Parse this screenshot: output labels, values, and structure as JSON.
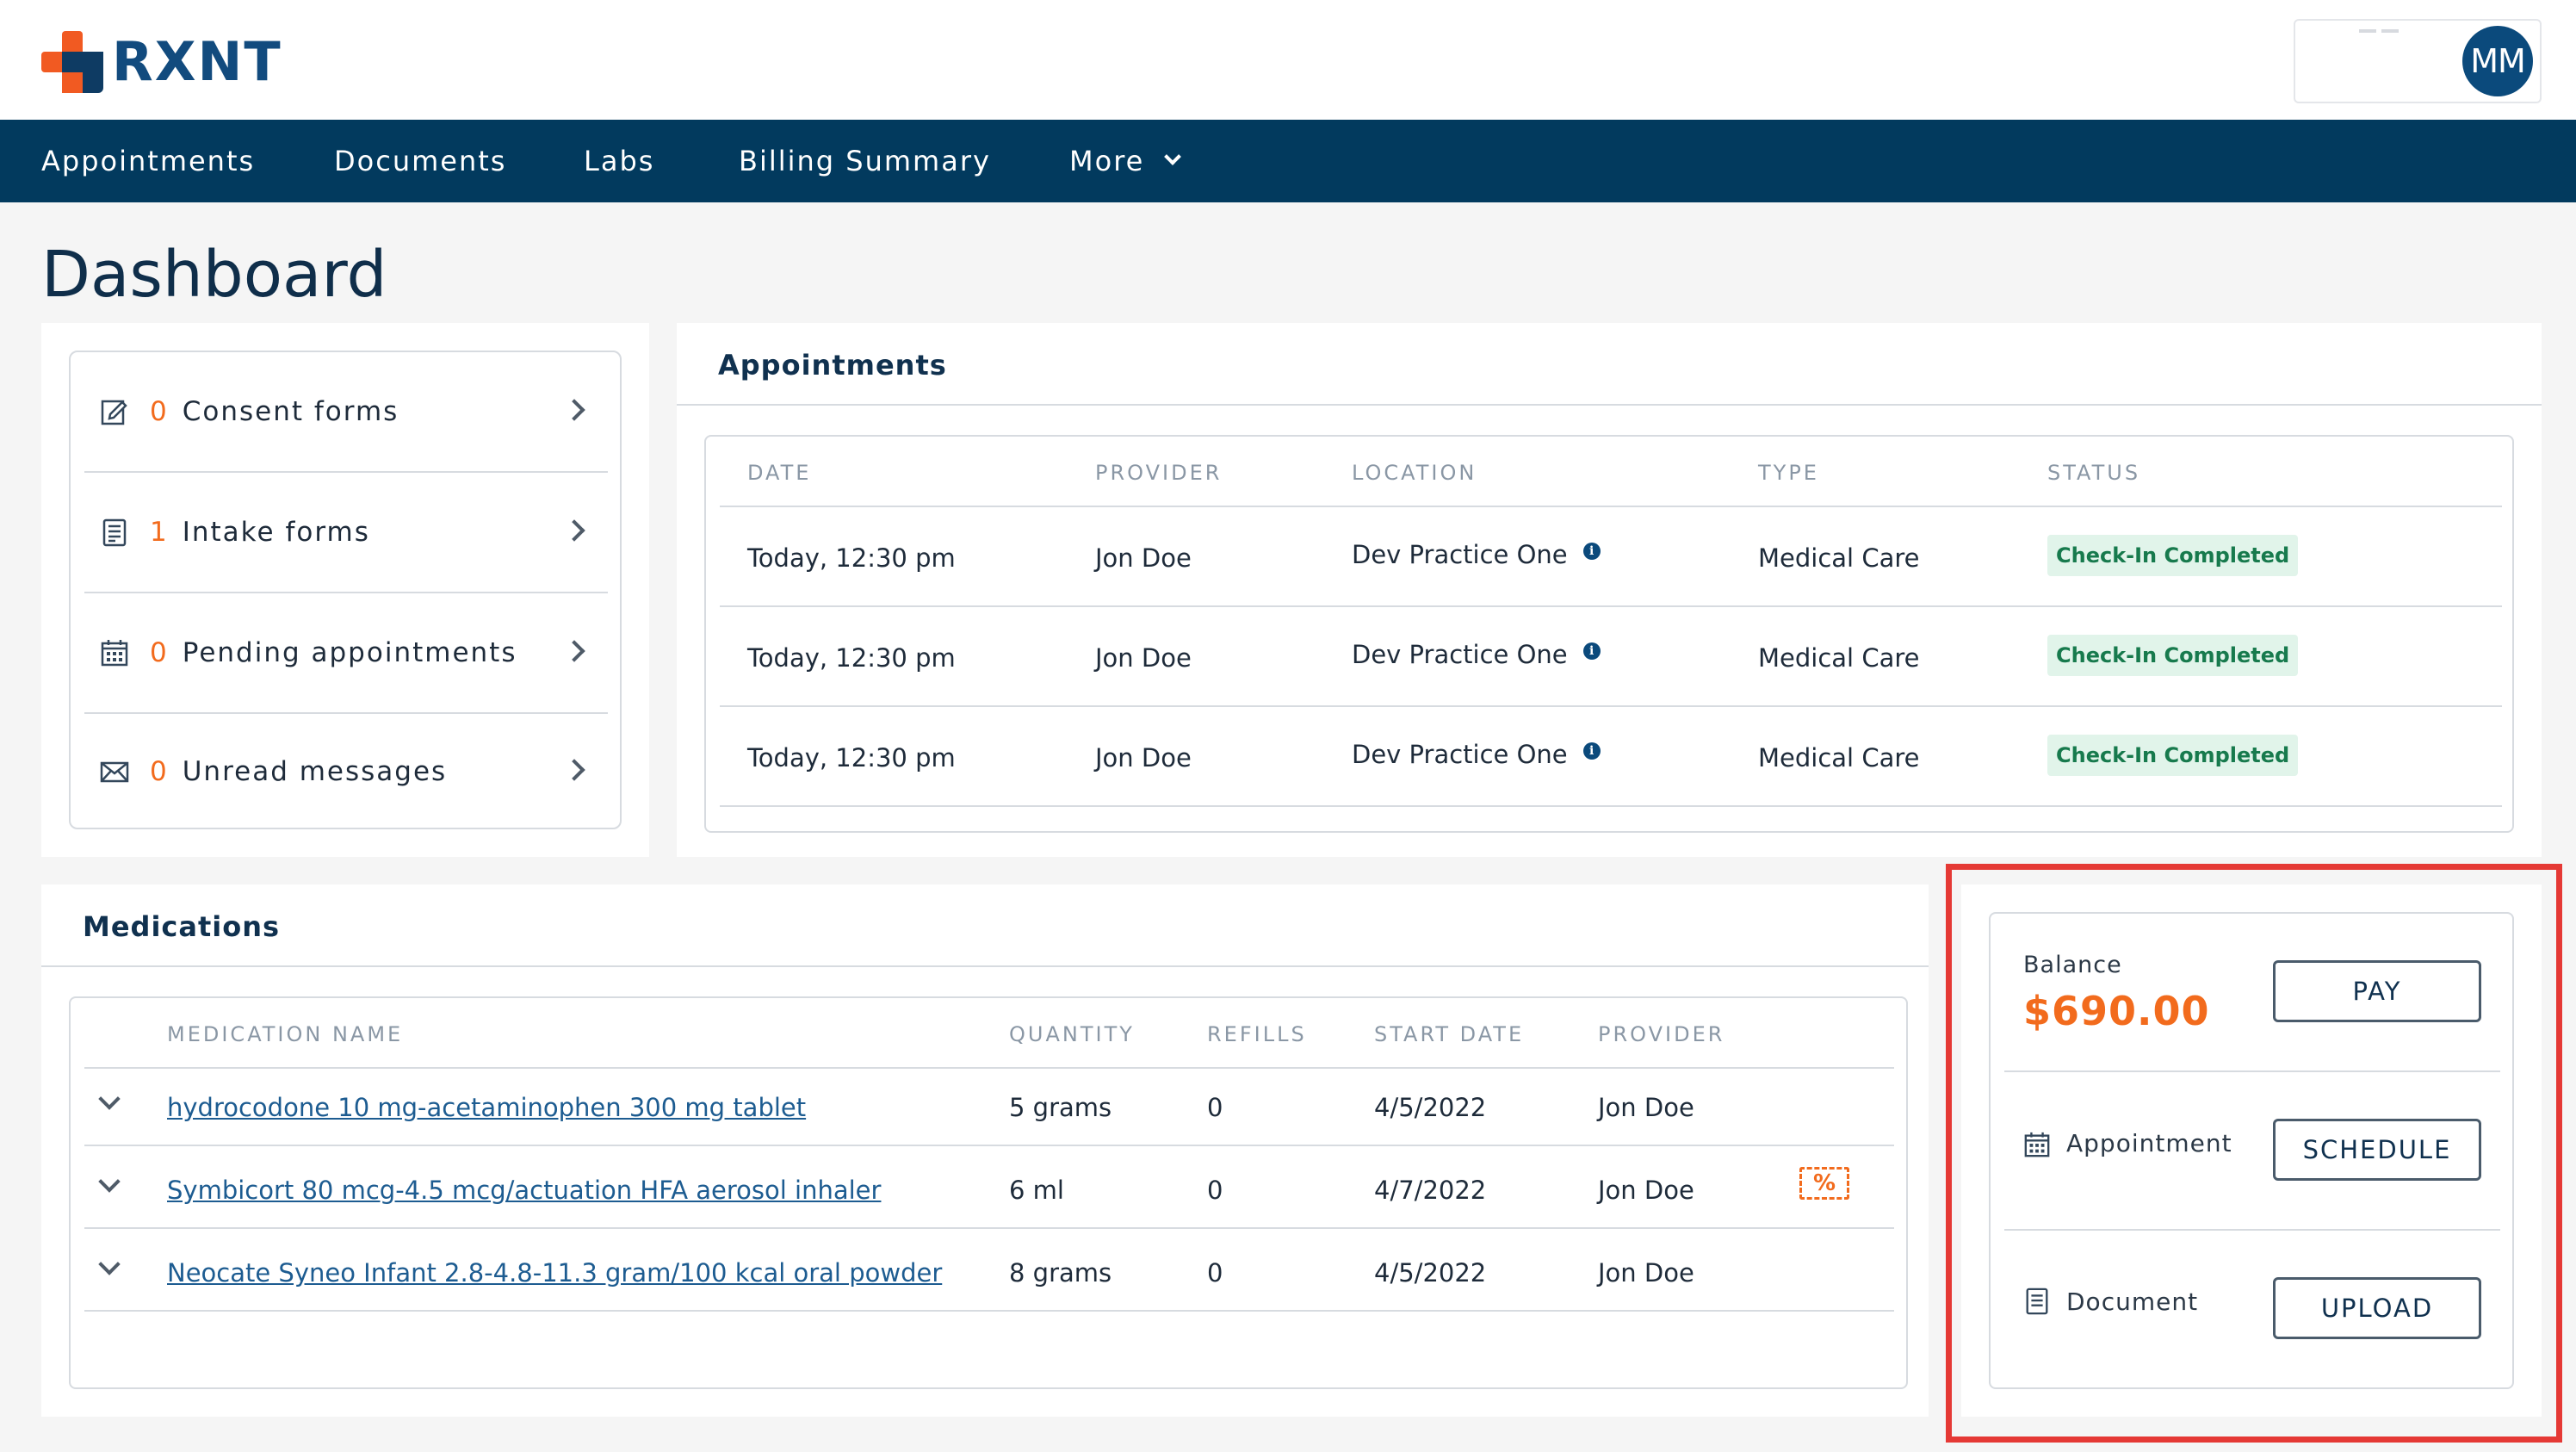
{
  "header": {
    "logo_text": "RXNT",
    "avatar_initials": "MM",
    "colors": {
      "brand_orange": "#f15a22",
      "brand_navy": "#023a5e",
      "accent_blue": "#0b4a7c"
    }
  },
  "nav": {
    "items": [
      {
        "label": "Appointments"
      },
      {
        "label": "Documents"
      },
      {
        "label": "Labs"
      },
      {
        "label": "Billing Summary"
      },
      {
        "label": "More"
      }
    ]
  },
  "page": {
    "title": "Dashboard"
  },
  "quick_links": [
    {
      "count": "0",
      "label": "Consent forms",
      "icon": "edit-form-icon"
    },
    {
      "count": "1",
      "label": "Intake forms",
      "icon": "clipboard-icon"
    },
    {
      "count": "0",
      "label": "Pending appointments",
      "icon": "calendar-icon"
    },
    {
      "count": "0",
      "label": "Unread messages",
      "icon": "envelope-icon"
    }
  ],
  "appointments": {
    "title": "Appointments",
    "columns": [
      "DATE",
      "PROVIDER",
      "LOCATION",
      "TYPE",
      "STATUS"
    ],
    "rows": [
      {
        "date": "Today, 12:30 pm",
        "provider": "Jon Doe",
        "location": "Dev Practice One",
        "type": "Medical Care",
        "status": "Check-In Completed"
      },
      {
        "date": "Today, 12:30 pm",
        "provider": "Jon Doe",
        "location": "Dev Practice One",
        "type": "Medical Care",
        "status": "Check-In Completed"
      },
      {
        "date": "Today, 12:30 pm",
        "provider": "Jon Doe",
        "location": "Dev Practice One",
        "type": "Medical Care",
        "status": "Check-In Completed"
      }
    ],
    "info_glyph": "i"
  },
  "medications": {
    "title": "Medications",
    "columns": [
      "MEDICATION NAME",
      "QUANTITY",
      "REFILLS",
      "START DATE",
      "PROVIDER"
    ],
    "rows": [
      {
        "name": "hydrocodone 10 mg-acetaminophen 300 mg tablet",
        "quantity": "5 grams",
        "refills": "0",
        "start_date": "4/5/2022",
        "provider": "Jon Doe"
      },
      {
        "name": "Symbicort 80 mcg-4.5 mcg/actuation HFA aerosol inhaler",
        "quantity": "6 ml",
        "refills": "0",
        "start_date": "4/7/2022",
        "provider": "Jon Doe",
        "coupon_icon": "discount-coupon-icon",
        "coupon_glyph": "%"
      },
      {
        "name": "Neocate Syneo Infant 2.8-4.8-11.3 gram/100 kcal oral powder",
        "quantity": "8 grams",
        "refills": "0",
        "start_date": "4/5/2022",
        "provider": "Jon Doe"
      }
    ]
  },
  "actions": {
    "balance_label": "Balance",
    "balance_amount": "$690.00",
    "pay_label": "PAY",
    "appointment_label": "Appointment",
    "schedule_label": "SCHEDULE",
    "document_label": "Document",
    "upload_label": "UPLOAD"
  }
}
